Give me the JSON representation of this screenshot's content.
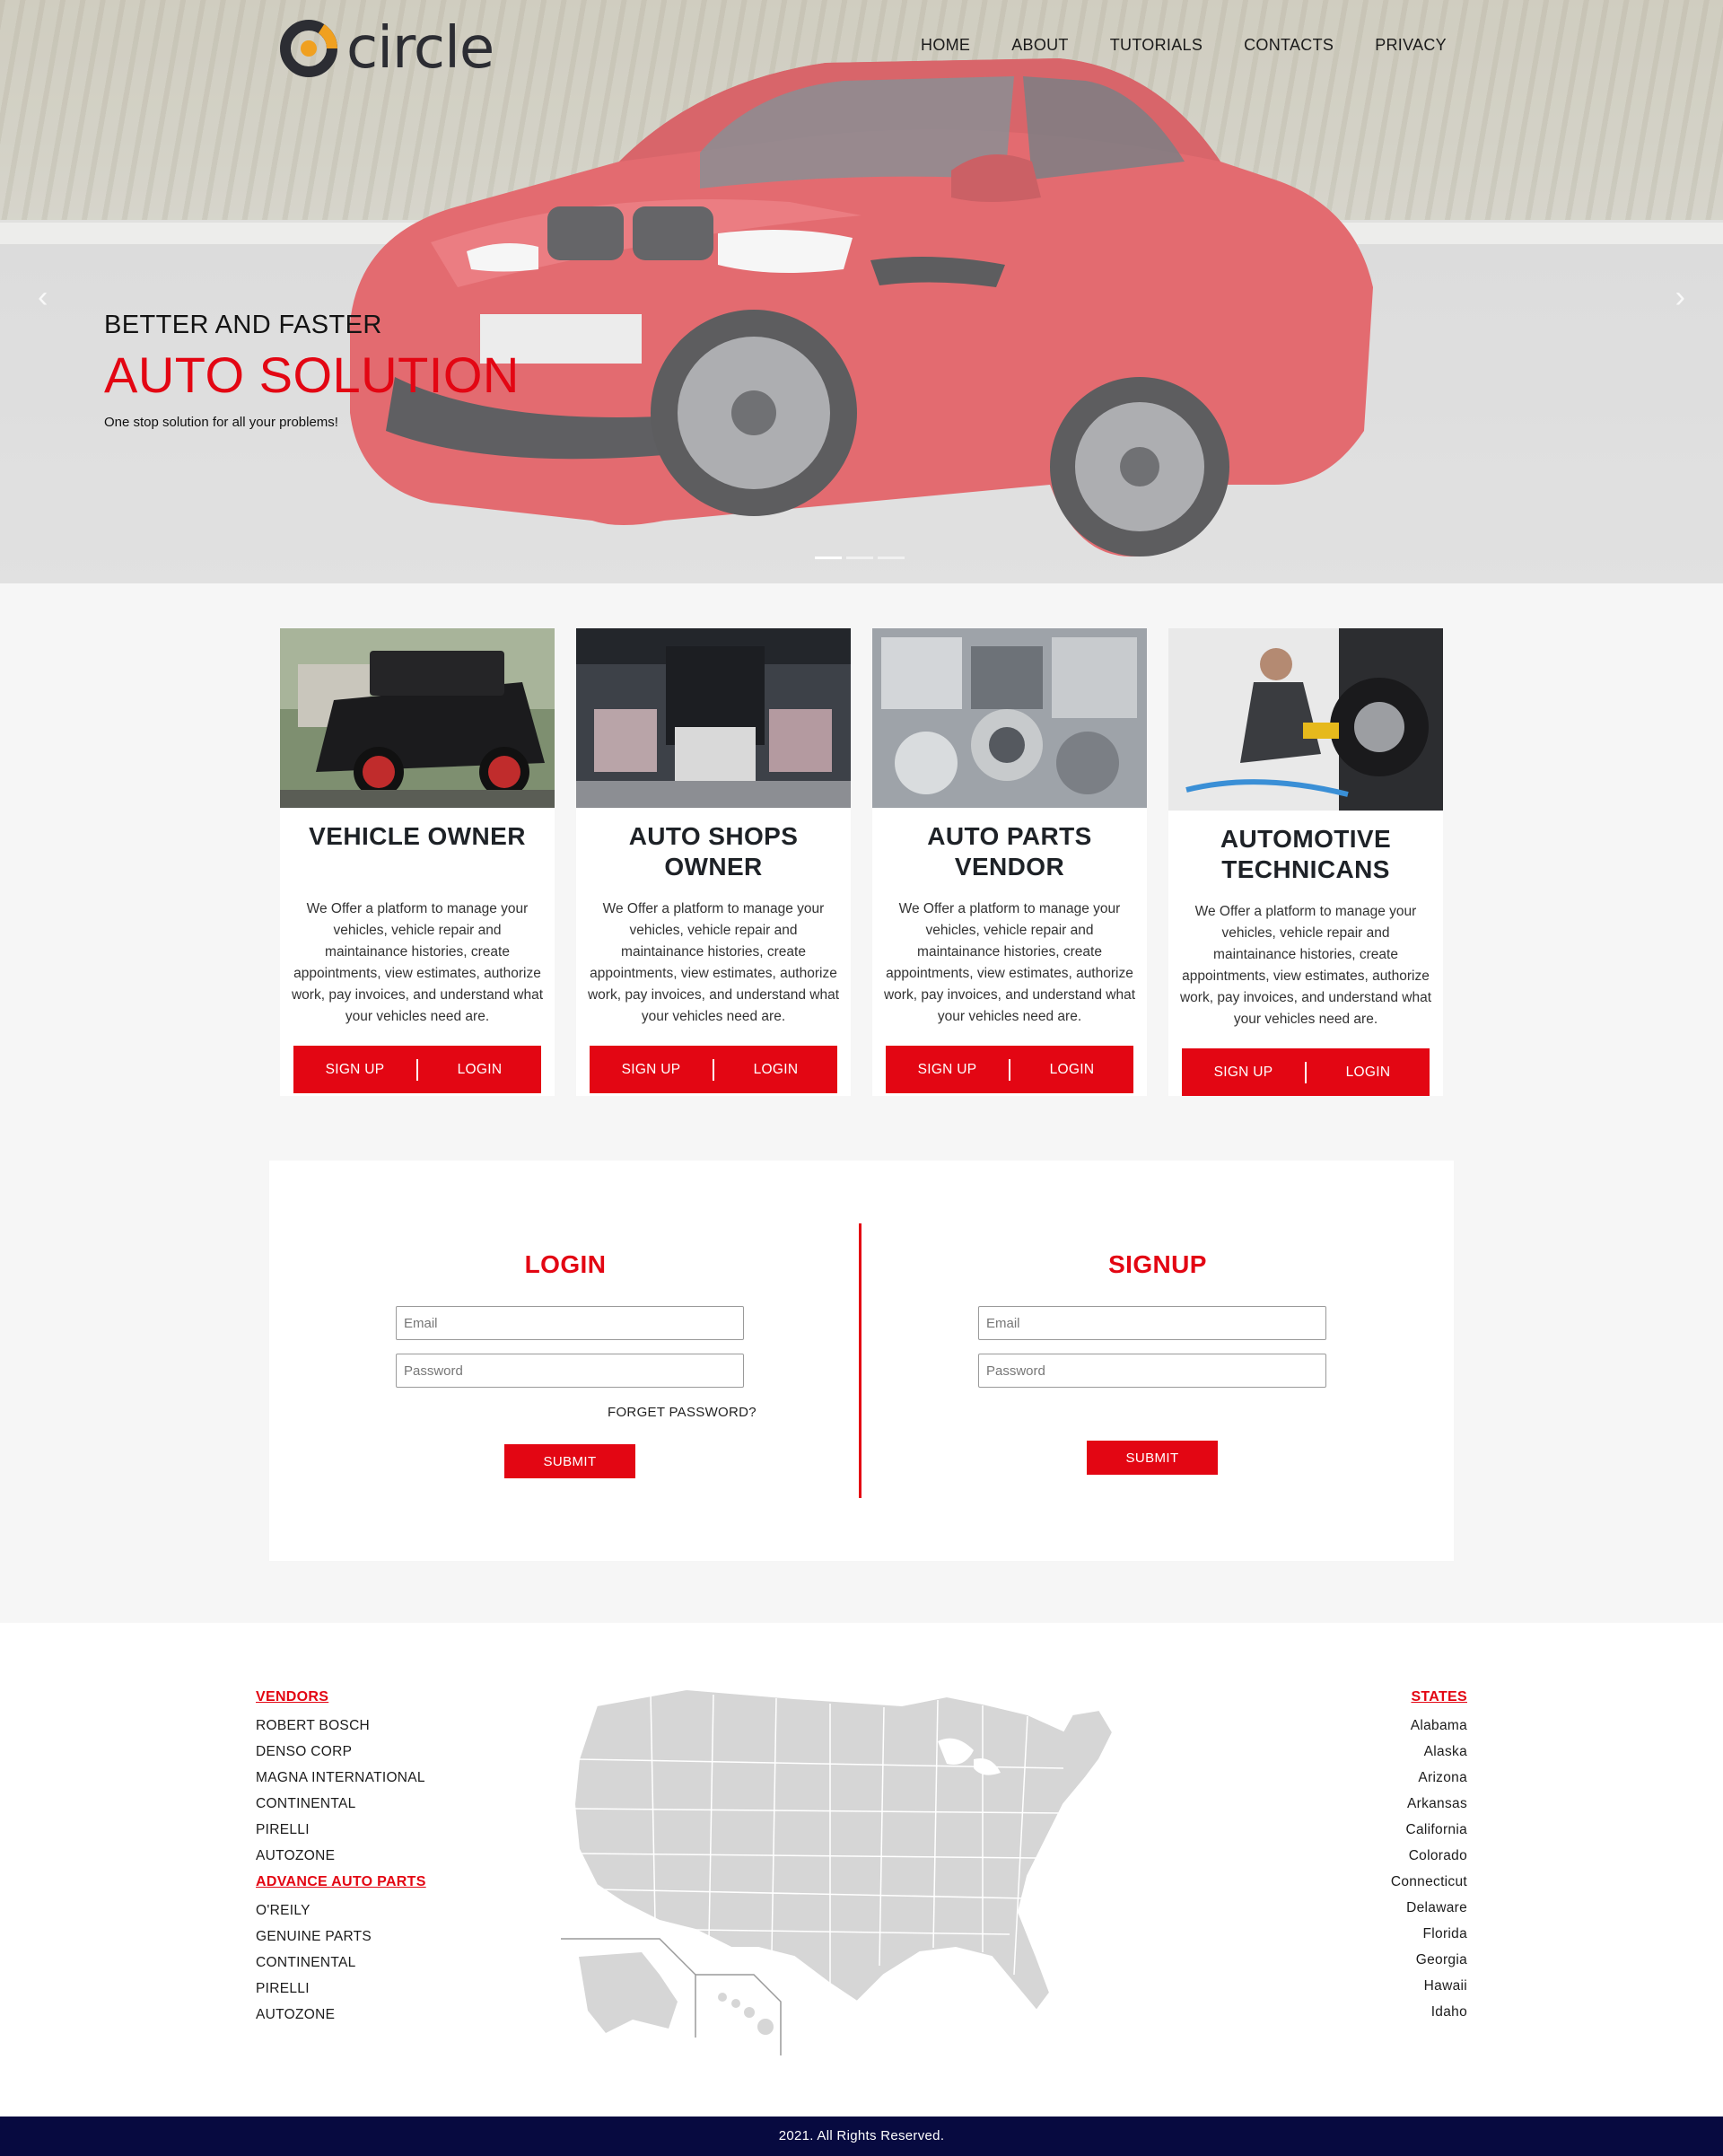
{
  "brand": {
    "name": "circle"
  },
  "nav": {
    "items": [
      {
        "label": "HOME"
      },
      {
        "label": "ABOUT"
      },
      {
        "label": "TUTORIALS"
      },
      {
        "label": "CONTACTS"
      },
      {
        "label": "PRIVACY"
      }
    ]
  },
  "hero": {
    "kicker": "BETTER AND FASTER",
    "title": "AUTO SOLUTION",
    "subtitle": "One stop solution for all your problems!",
    "slides": 3,
    "active_slide": 1
  },
  "cards": [
    {
      "title": "VEHICLE OWNER",
      "text": "We Offer a platform to manage your vehicles, vehicle repair and maintainance histories, create appointments, view estimates, authorize work, pay invoices, and understand what your vehicles need are.",
      "signup": "SIGN UP",
      "login": "LOGIN"
    },
    {
      "title": "AUTO SHOPS OWNER",
      "text": "We Offer a platform to manage your vehicles, vehicle repair and maintainance histories, create appointments, view estimates, authorize work, pay invoices, and understand what your vehicles need are.",
      "signup": "SIGN UP",
      "login": "LOGIN"
    },
    {
      "title": "AUTO PARTS VENDOR",
      "text": "We Offer a platform to manage your vehicles, vehicle repair and maintainance histories, create appointments, view estimates, authorize work, pay invoices, and understand what your vehicles need are.",
      "signup": "SIGN UP",
      "login": "LOGIN"
    },
    {
      "title": "AUTOMOTIVE TECHNICANS",
      "text": "We Offer a platform to manage your vehicles, vehicle repair and maintainance histories, create appointments, view estimates, authorize work, pay invoices, and understand what your vehicles need are.",
      "signup": "SIGN UP",
      "login": "LOGIN"
    }
  ],
  "login": {
    "title": "LOGIN",
    "email_placeholder": "Email",
    "password_placeholder": "Password",
    "forgot": "FORGET PASSWORD?",
    "submit": "SUBMIT"
  },
  "signup": {
    "title": "SIGNUP",
    "email_placeholder": "Email",
    "password_placeholder": "Password",
    "submit": "SUBMIT"
  },
  "footer": {
    "vendors_title": "VENDORS",
    "vendors": [
      "ROBERT BOSCH",
      "DENSO CORP",
      "MAGNA INTERNATIONAL",
      "CONTINENTAL",
      "PIRELLI",
      "AUTOZONE"
    ],
    "advance_title": "ADVANCE AUTO PARTS",
    "advance": [
      "O'REILY",
      "GENUINE PARTS",
      "CONTINENTAL",
      "PIRELLI",
      "AUTOZONE"
    ],
    "states_title": "STATES",
    "states": [
      "Alabama",
      "Alaska",
      "Arizona",
      "Arkansas",
      "California",
      "Colorado",
      "Connecticut",
      "Delaware",
      "Florida",
      "Georgia",
      "Hawaii",
      "Idaho"
    ],
    "copyright": "2021. All Rights Reserved."
  },
  "colors": {
    "accent": "#e30613",
    "footer_bar": "#070a40",
    "logo_ring": "#f0a020"
  }
}
